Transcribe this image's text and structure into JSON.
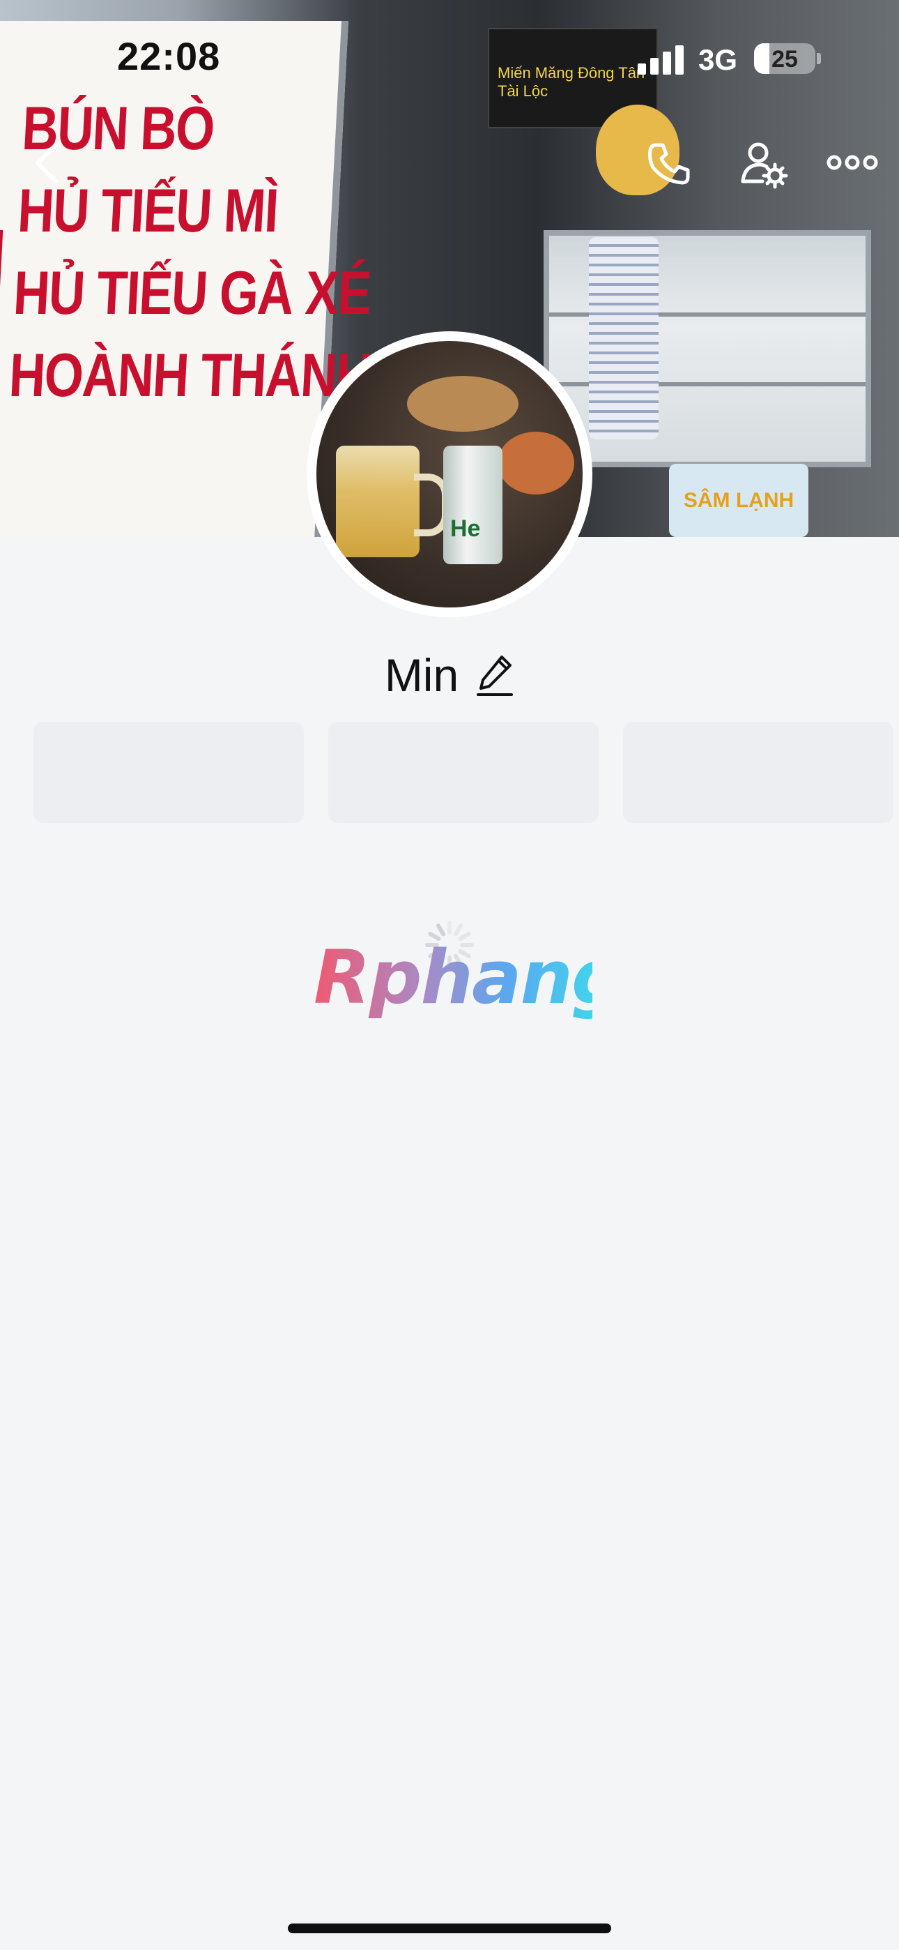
{
  "status_bar": {
    "time": "22:08",
    "network": "3G",
    "battery": "25",
    "battery_level": 0.25
  },
  "cover_photo": {
    "sign_lines": [
      "BÚN BÒ",
      "HỦ TIẾU MÌ",
      "HỦ TIẾU GÀ XÉ",
      "HOÀNH THÁNH"
    ],
    "poster_text": "Miến Măng Đông Tân Tài Lộc",
    "sticker_text": "SÂM LẠNH"
  },
  "nav": {
    "back": "back-icon",
    "call": "phone-icon",
    "user_settings": "user-settings-icon",
    "more": "more-icon"
  },
  "avatar": {
    "can_label": "He"
  },
  "profile": {
    "name": "Min"
  },
  "watermark": "Rphang",
  "colors": {
    "background": "#f4f5f7",
    "placeholder": "#eceef1",
    "sign_red": "#c8102e"
  }
}
